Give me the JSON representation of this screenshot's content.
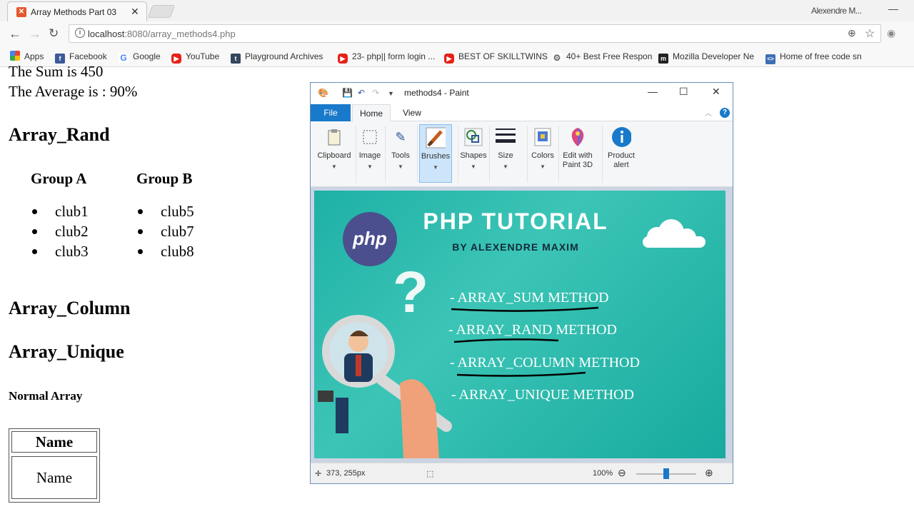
{
  "browser": {
    "tab_title": "Array Methods Part 03",
    "profile_name": "Alexendre M...",
    "url_host": "localhost",
    "url_rest": ":8080/array_methods4.php",
    "bookmarks": [
      {
        "label": "Apps",
        "icon": "apps-grid-icon"
      },
      {
        "label": "Facebook",
        "icon": "facebook-icon"
      },
      {
        "label": "Google",
        "icon": "google-icon"
      },
      {
        "label": "YouTube",
        "icon": "youtube-icon"
      },
      {
        "label": "Playground Archives",
        "icon": "tumblr-icon"
      },
      {
        "label": "23- php|| form login ...",
        "icon": "youtube-icon"
      },
      {
        "label": "BEST OF SKILLTWINS",
        "icon": "youtube-icon"
      },
      {
        "label": "40+ Best Free Respon",
        "icon": "gear-icon"
      },
      {
        "label": "Mozilla Developer Ne",
        "icon": "mozilla-icon"
      },
      {
        "label": "Home of free code sn",
        "icon": "code-icon"
      }
    ]
  },
  "page": {
    "sum_line": "The Sum is 450",
    "average_line": "The Average is : 90%",
    "array_rand_heading": "Array_Rand",
    "group_a_heading": "Group A",
    "group_b_heading": "Group B",
    "group_a_items": [
      "club1",
      "club2",
      "club3"
    ],
    "group_b_items": [
      "club5",
      "club7",
      "club8"
    ],
    "array_column_heading": "Array_Column",
    "array_unique_heading": "Array_Unique",
    "normal_array_heading": "Normal Array",
    "table_header": "Name",
    "table_cell": "Name"
  },
  "paint": {
    "title": "methods4 - Paint",
    "tabs": {
      "file": "File",
      "home": "Home",
      "view": "View"
    },
    "ribbon": [
      {
        "label": "Clipboard",
        "icon": "clipboard-icon"
      },
      {
        "label": "Image",
        "icon": "select-icon"
      },
      {
        "label": "Tools",
        "icon": "tools-icon"
      },
      {
        "label": "Brushes",
        "icon": "brush-icon"
      },
      {
        "label": "Shapes",
        "icon": "shapes-icon"
      },
      {
        "label": "Size",
        "icon": "size-icon"
      },
      {
        "label": "Colors",
        "icon": "palette-icon"
      },
      {
        "label": "Edit with Paint 3D",
        "icon": "paint3d-icon"
      },
      {
        "label": "Product alert",
        "icon": "info-icon"
      }
    ],
    "image": {
      "title": "PHP TUTORIAL",
      "subtitle": "BY ALEXENDRE MAXIM",
      "logo_text": "php",
      "items": [
        "- ARRAY_SUM METHOD",
        "- ARRAY_RAND METHOD",
        "- ARRAY_COLUMN METHOD",
        "- ARRAY_UNIQUE METHOD"
      ]
    },
    "status": {
      "cursor_pos": "373, 255px",
      "zoom": "100%"
    }
  }
}
